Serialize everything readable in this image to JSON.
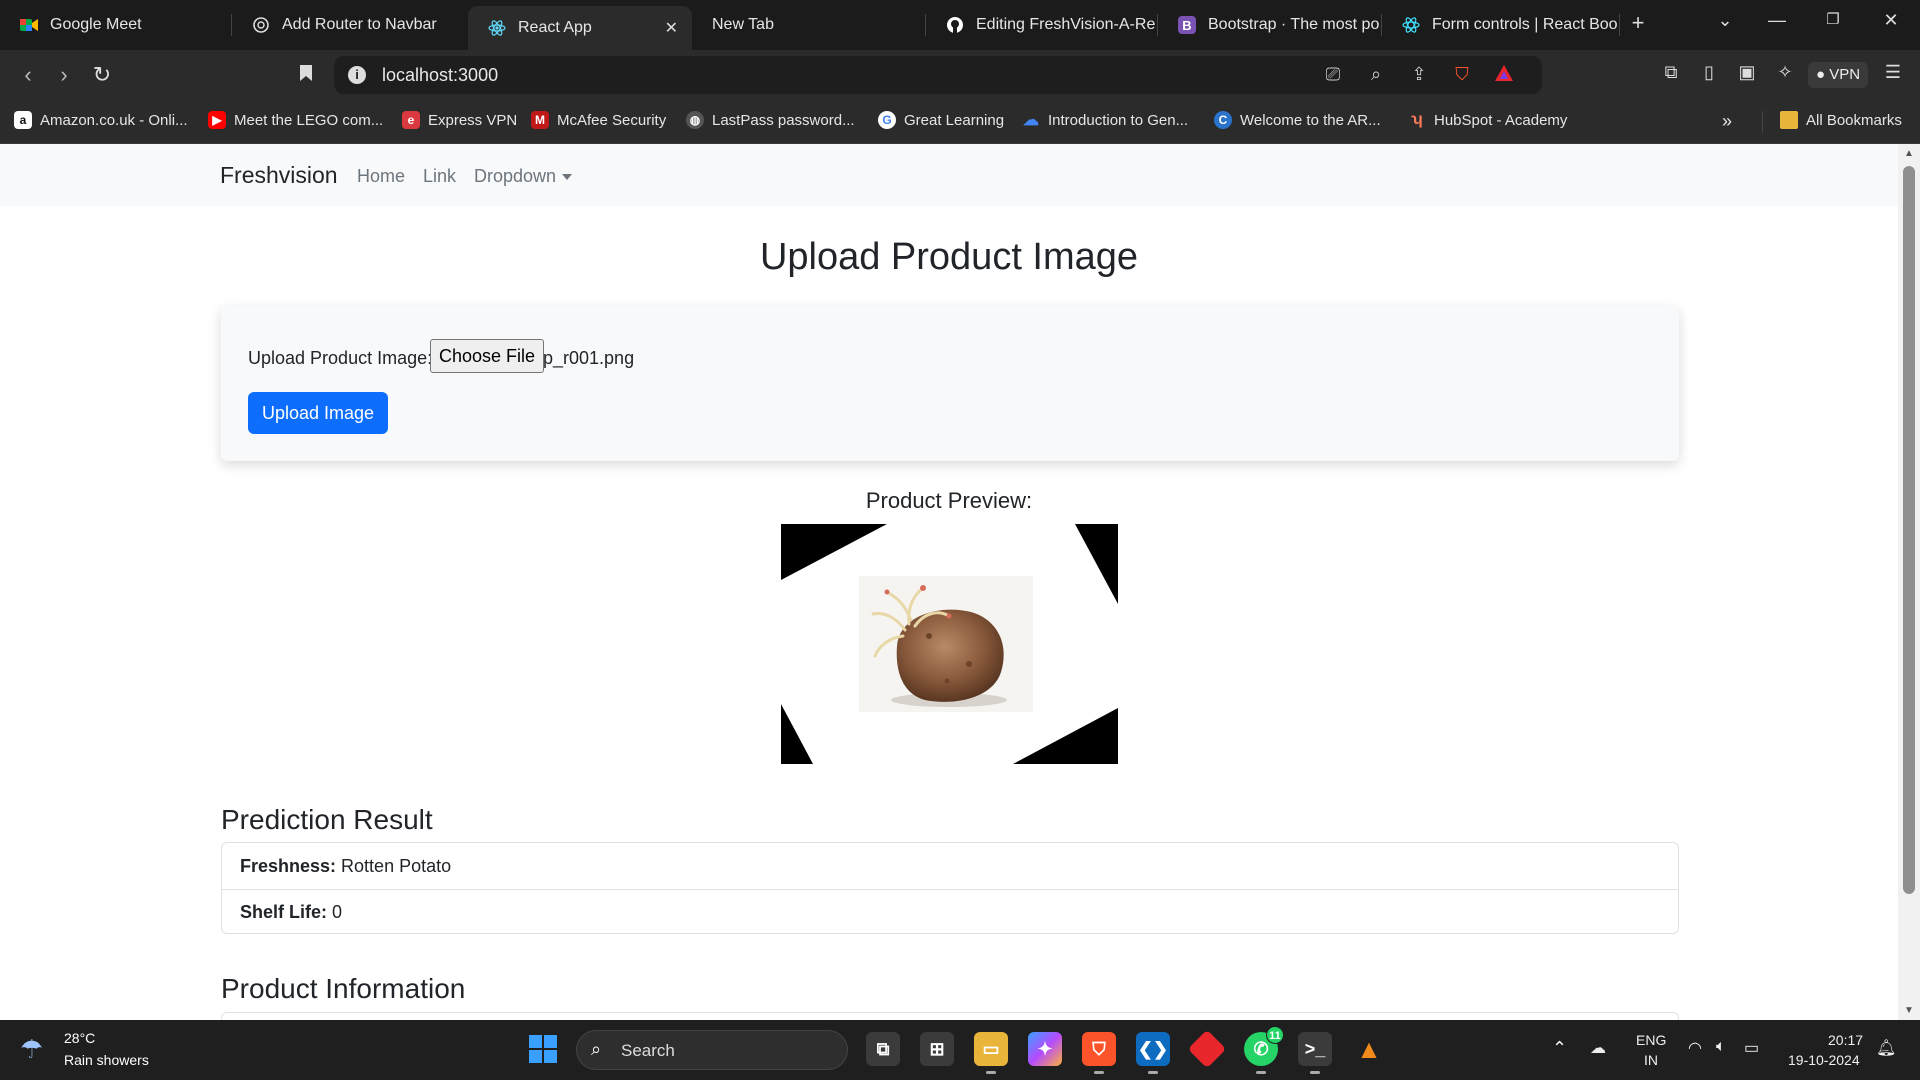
{
  "browser": {
    "tabs": [
      {
        "title": "Google Meet",
        "icon": "google-meet-icon"
      },
      {
        "title": "Add Router to Navbar",
        "icon": "chatgpt-icon"
      },
      {
        "title": "React App",
        "icon": "react-icon",
        "active": true
      },
      {
        "title": "New Tab",
        "icon": ""
      },
      {
        "title": "Editing FreshVision-A-Re",
        "icon": "github-icon"
      },
      {
        "title": "Bootstrap · The most pop",
        "icon": "bootstrap-icon"
      },
      {
        "title": "Form controls | React Boo",
        "icon": "react-bootstrap-icon"
      }
    ],
    "new_tab_symbol": "+",
    "close_symbol": "✕",
    "url": "localhost:3000",
    "vpn_label": "VPN",
    "bookmarks": [
      {
        "label": "Amazon.co.uk - Onli...",
        "icon": "amazon-icon",
        "glyph": "a",
        "color": "#ffffff"
      },
      {
        "label": "Meet the LEGO com...",
        "icon": "youtube-icon",
        "glyph": "▶",
        "color": "#ff0000"
      },
      {
        "label": "Express VPN",
        "icon": "expressvpn-icon",
        "glyph": "e",
        "color": "#da3940"
      },
      {
        "label": "McAfee Security",
        "icon": "mcafee-icon",
        "glyph": "M",
        "color": "#c01818"
      },
      {
        "label": "LastPass password...",
        "icon": "globe-icon",
        "glyph": "◍",
        "color": "#555555"
      },
      {
        "label": "Great Learning",
        "icon": "google-icon",
        "glyph": "G",
        "color": "#ffffff"
      },
      {
        "label": "Introduction to Gen...",
        "icon": "google-cloud-icon",
        "glyph": "☁",
        "color": "#4285f4"
      },
      {
        "label": "Welcome to the AR...",
        "icon": "coursera-icon",
        "glyph": "C",
        "color": "#2a73cc"
      },
      {
        "label": "HubSpot - Academy",
        "icon": "hubspot-icon",
        "glyph": "ʮ",
        "color": "#ff7a59"
      }
    ],
    "bookmarks_overflow": "»",
    "all_bookmarks": "All Bookmarks"
  },
  "page": {
    "navbar": {
      "brand": "Freshvision",
      "links": [
        "Home",
        "Link",
        "Dropdown"
      ]
    },
    "title": "Upload Product Image",
    "upload_form": {
      "label": "Upload Product Image:",
      "choose_file": "Choose File",
      "file_name": "p_r001.png",
      "button": "Upload Image"
    },
    "preview_heading": "Product Preview:",
    "prediction_heading": "Prediction Result",
    "prediction": [
      {
        "key": "Freshness:",
        "value": "Rotten Potato"
      },
      {
        "key": "Shelf Life:",
        "value": "0"
      }
    ],
    "info_heading": "Product Information"
  },
  "taskbar": {
    "temperature": "28°C",
    "weather": "Rain showers",
    "search_placeholder": "Search",
    "whatsapp_badge": "11",
    "language": "ENG",
    "region": "IN",
    "time": "20:17",
    "date": "19-10-2024"
  },
  "colors": {
    "primary": "#0d6efd",
    "navbar_bg": "#f8f9fa",
    "chrome_bg": "#2b2b2b"
  }
}
